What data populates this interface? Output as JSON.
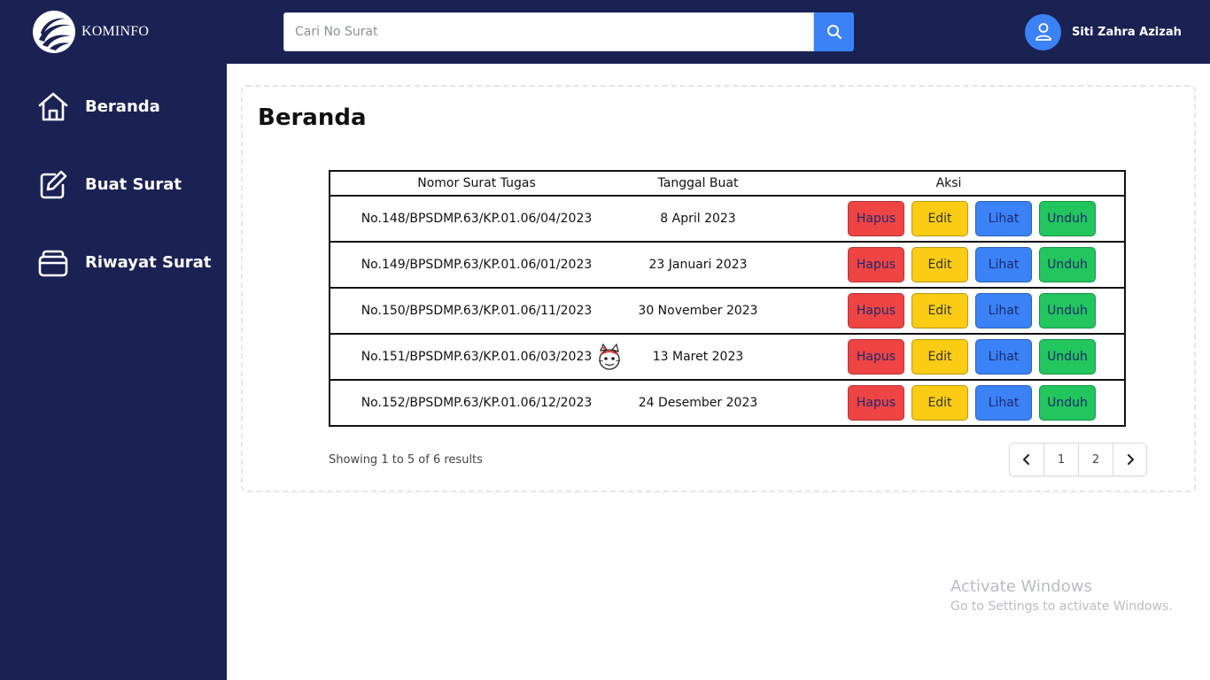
{
  "brand": {
    "logo_text": "KOMINFO"
  },
  "search": {
    "placeholder": "Cari No Surat",
    "value": ""
  },
  "user": {
    "name": "Siti Zahra Azizah"
  },
  "sidebar": {
    "items": [
      {
        "label": "Beranda",
        "icon": "home-icon"
      },
      {
        "label": "Buat Surat",
        "icon": "edit-icon"
      },
      {
        "label": "Riwayat Surat",
        "icon": "archive-icon"
      }
    ]
  },
  "main": {
    "title": "Beranda",
    "table": {
      "headers": [
        "Nomor Surat Tugas",
        "Tanggal Buat",
        "Aksi"
      ],
      "rows": [
        {
          "nomor": "No.148/BPSDMP.63/KP.01.06/04/2023",
          "tanggal": "8 April 2023"
        },
        {
          "nomor": "No.149/BPSDMP.63/KP.01.06/01/2023",
          "tanggal": "23 Januari 2023"
        },
        {
          "nomor": "No.150/BPSDMP.63/KP.01.06/11/2023",
          "tanggal": "30 November 2023"
        },
        {
          "nomor": "No.151/BPSDMP.63/KP.01.06/03/2023",
          "tanggal": "13 Maret 2023"
        },
        {
          "nomor": "No.152/BPSDMP.63/KP.01.06/12/2023",
          "tanggal": "24 Desember 2023"
        }
      ],
      "actions": {
        "delete": "Hapus",
        "edit": "Edit",
        "view": "Lihat",
        "download": "Unduh"
      }
    },
    "showing": "Showing 1 to 5 of 6 results",
    "pagination": {
      "pages": [
        "1",
        "2"
      ],
      "prev_icon": "chevron-left-icon",
      "next_icon": "chevron-right-icon"
    }
  },
  "watermark": {
    "title": "Activate Windows",
    "subtitle": "Go to Settings to activate Windows."
  },
  "colors": {
    "navy": "#1a2254",
    "accent_blue": "#3b82f6",
    "delete_red": "#ef4444",
    "edit_yellow": "#facc15",
    "download_green": "#22c55e"
  }
}
